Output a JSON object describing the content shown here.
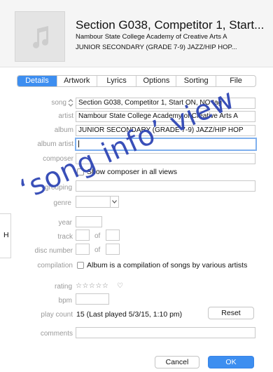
{
  "header": {
    "title": "Section G038, Competitor 1, Start...",
    "artist": "Nambour State College Academy of Creative Arts A",
    "album": "JUNIOR SECONDARY (GRADE 7-9) JAZZ/HIP HOP..."
  },
  "tabs": [
    "Details",
    "Artwork",
    "Lyrics",
    "Options",
    "Sorting",
    "File"
  ],
  "labels": {
    "song": "song",
    "artist": "artist",
    "album": "album",
    "album_artist": "album artist",
    "composer": "composer",
    "grouping": "grouping",
    "genre": "genre",
    "year": "year",
    "track": "track",
    "track_of": "of",
    "disc": "disc number",
    "disc_of": "of",
    "compilation": "compilation",
    "rating": "rating",
    "bpm": "bpm",
    "play_count": "play count",
    "comments": "comments"
  },
  "values": {
    "song": "Section G038, Competitor 1, Start ON, NO tag",
    "artist": "Nambour State College Academy of Creative Arts A",
    "album": "JUNIOR SECONDARY (GRADE 7-9) JAZZ/HIP HOP",
    "album_artist": "",
    "composer": "",
    "grouping": "",
    "genre": "",
    "year": "",
    "track": "",
    "track_total": "",
    "disc": "",
    "disc_total": "",
    "bpm": "",
    "comments": "",
    "play_count": "15 (Last played 5/3/15, 1:10 pm)",
    "rating": "☆☆☆☆☆",
    "rating_value": 0
  },
  "checkboxes": {
    "show_composer": "Show composer in all views",
    "compilation": "Album is a compilation of songs by various artists"
  },
  "buttons": {
    "reset": "Reset",
    "cancel": "Cancel",
    "ok": "OK"
  },
  "side_tab": {
    "letter": "H"
  },
  "watermark": "‘song info’ view",
  "colors": {
    "accent": "#3d8ef0",
    "watermark": "#2f46b5"
  },
  "icons": {
    "artwork_placeholder": "music-note-icon",
    "sort_arrows": "up-down-chevron-icon",
    "heart": "heart-icon",
    "star": "star-icon"
  }
}
